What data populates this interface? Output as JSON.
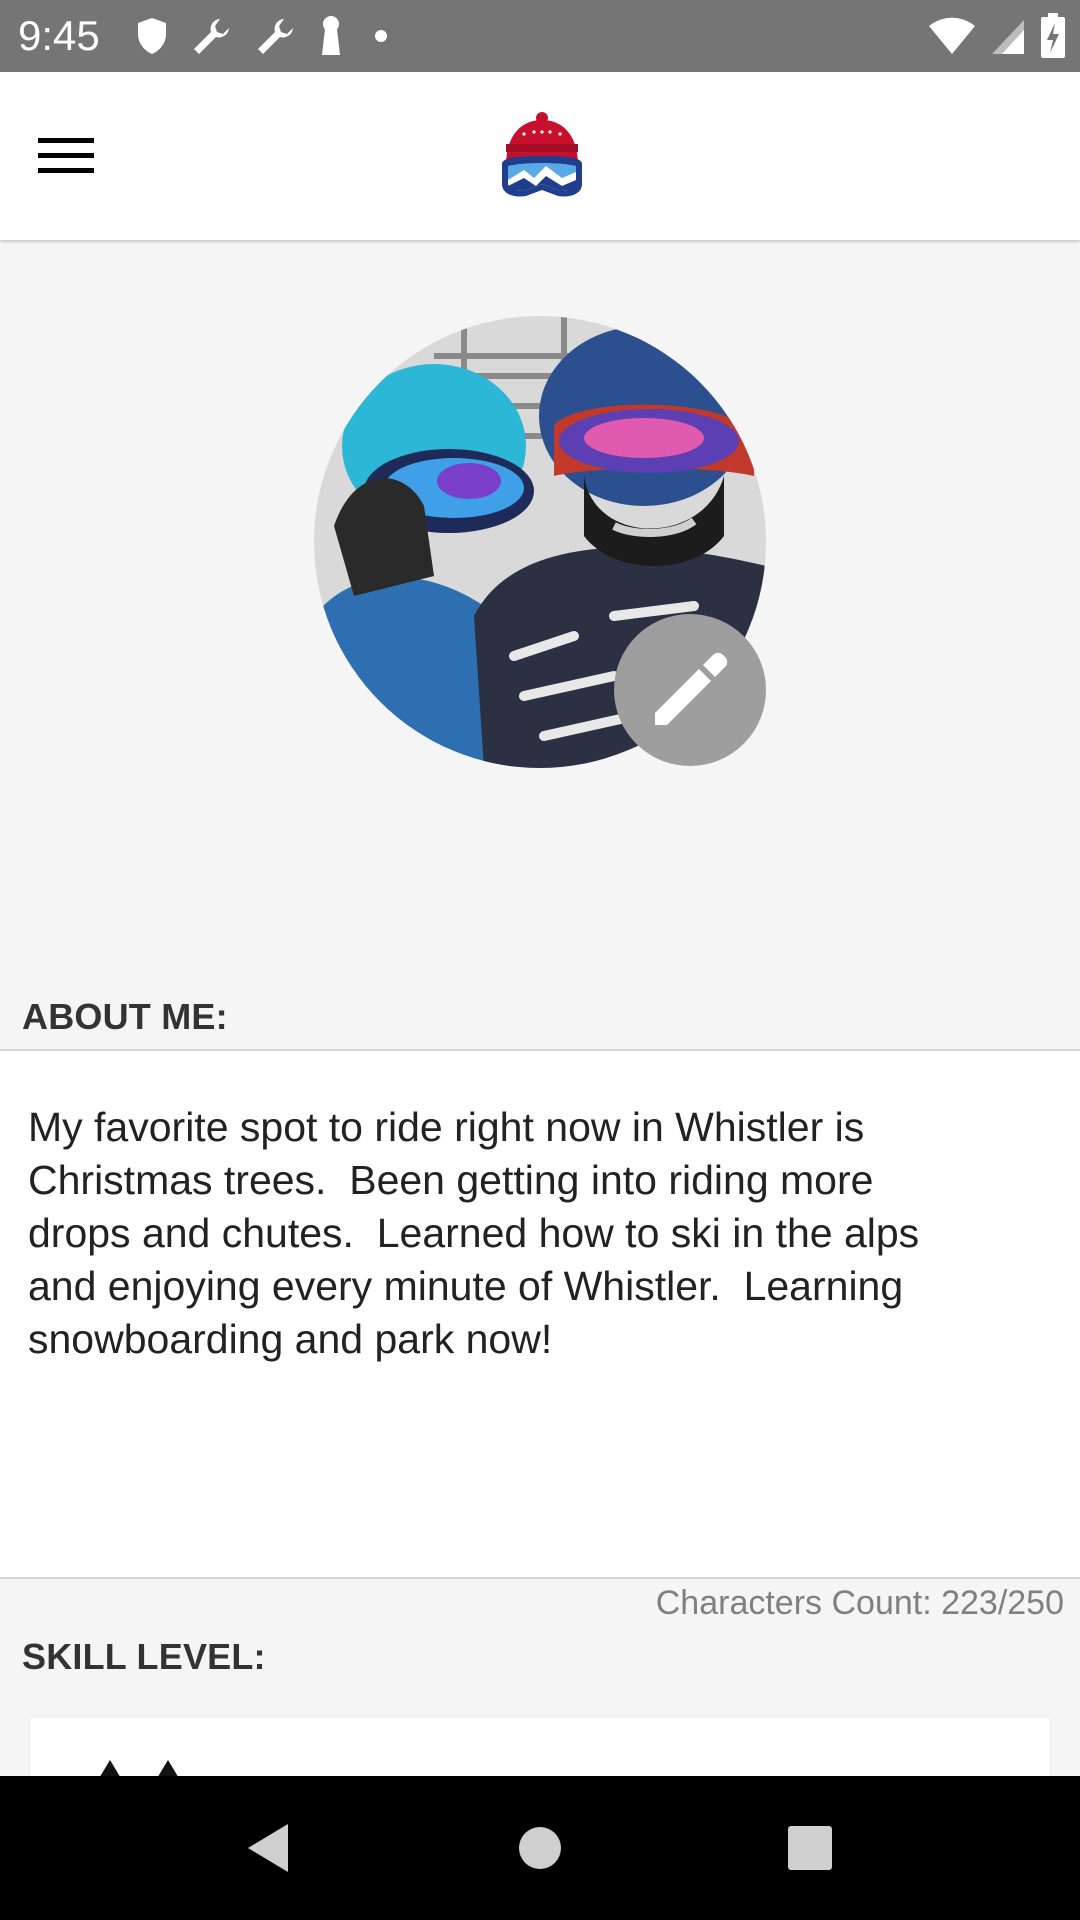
{
  "status_bar": {
    "time": "9:45",
    "left_icons": [
      "shield-icon",
      "wrench-icon",
      "wrench-icon",
      "keyhole-icon",
      "dot-icon"
    ],
    "right_icons": [
      "wifi-icon",
      "signal-icon",
      "battery-charging-icon"
    ]
  },
  "app_bar": {
    "menu_icon": "hamburger-menu-icon",
    "logo": "ski-beanie-goggles-logo"
  },
  "profile": {
    "avatar": "profile-photo",
    "edit_icon": "pencil-icon"
  },
  "about": {
    "label": "ABOUT ME:",
    "text": "My favorite spot to ride right now in Whistler is\nChristmas trees.  Been getting into riding more\ndrops and chutes.  Learned how to ski in the alps\nand enjoying every minute of Whistler.  Learning\nsnowboarding and park now!",
    "char_count": "Characters Count: 223/250"
  },
  "skill": {
    "label": "SKILL LEVEL:"
  },
  "nav_bar": {
    "buttons": [
      "back-icon",
      "home-icon",
      "recents-icon"
    ]
  },
  "colors": {
    "status_bar": "#757575",
    "app_bar": "#ffffff",
    "background": "#f5f5f5",
    "edit_button": "#9e9e9e",
    "logo_red": "#c8102e",
    "logo_blue": "#1f3f8c"
  }
}
